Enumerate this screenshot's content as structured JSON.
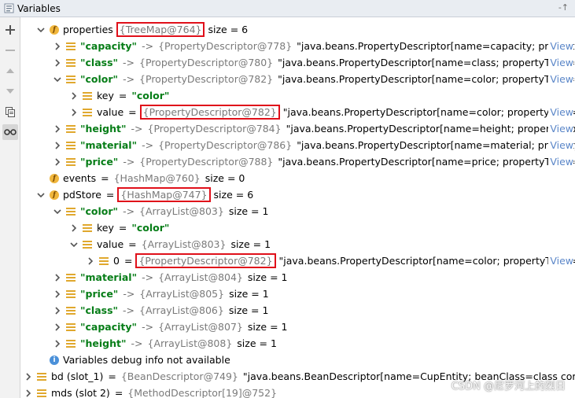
{
  "window": {
    "title": "Variables",
    "pin_glyph": "-↑"
  },
  "toolbar": [
    {
      "name": "add-watch-button",
      "icon": "plus-icon"
    },
    {
      "name": "remove-watch-button",
      "icon": "minus-icon"
    },
    {
      "name": "move-up-button",
      "icon": "arrow-up-icon"
    },
    {
      "name": "move-down-button",
      "icon": "arrow-down-icon"
    },
    {
      "name": "copy-button",
      "icon": "copy-icon"
    },
    {
      "name": "show-watches-button",
      "icon": "glasses-icon"
    }
  ],
  "rows": [
    {
      "indent": 0,
      "arrow": "down",
      "icon": "field",
      "name": "properties",
      "ref": "{TreeMap@764}",
      "boxed": true,
      "size": "size = 6"
    },
    {
      "indent": 1,
      "arrow": "right",
      "icon": "bars",
      "str": "\"capacity\"",
      "arr": "->",
      "ref": "{PropertyDescriptor@778}",
      "val": "\"java.beans.PropertyDescriptor[name=capacity; propertyTy",
      "view": "View"
    },
    {
      "indent": 1,
      "arrow": "right",
      "icon": "bars",
      "str": "\"class\"",
      "arr": "->",
      "ref": "{PropertyDescriptor@780}",
      "val": "\"java.beans.PropertyDescriptor[name=class; propertyType=cla",
      "view": "View"
    },
    {
      "indent": 1,
      "arrow": "down",
      "icon": "bars",
      "str": "\"color\"",
      "arr": "->",
      "ref": "{PropertyDescriptor@782}",
      "val": "\"java.beans.PropertyDescriptor[name=color; propertyType=cl",
      "view": "View"
    },
    {
      "indent": 2,
      "arrow": "right",
      "icon": "bars",
      "name": "key",
      "eq": "=",
      "str": "\"color\""
    },
    {
      "indent": 2,
      "arrow": "right",
      "icon": "bars",
      "name": "value",
      "eq": "=",
      "ref": "{PropertyDescriptor@782}",
      "boxed": true,
      "val": "\"java.beans.PropertyDescriptor[name=color; propertyType=cl",
      "view": "View"
    },
    {
      "indent": 1,
      "arrow": "right",
      "icon": "bars",
      "str": "\"height\"",
      "arr": "->",
      "ref": "{PropertyDescriptor@784}",
      "val": "\"java.beans.PropertyDescriptor[name=height; propertyType:",
      "view": "View"
    },
    {
      "indent": 1,
      "arrow": "right",
      "icon": "bars",
      "str": "\"material\"",
      "arr": "->",
      "ref": "{PropertyDescriptor@786}",
      "val": "\"java.beans.PropertyDescriptor[name=material; propertyTy",
      "view": "View"
    },
    {
      "indent": 1,
      "arrow": "right",
      "icon": "bars",
      "str": "\"price\"",
      "arr": "->",
      "ref": "{PropertyDescriptor@788}",
      "val": "\"java.beans.PropertyDescriptor[name=price; propertyType=cla",
      "view": "View"
    },
    {
      "indent": 0,
      "arrow": "none",
      "icon": "field",
      "name": "events",
      "eq": "=",
      "ref": "{HashMap@760}",
      "size": "size = 0"
    },
    {
      "indent": 0,
      "arrow": "down",
      "icon": "field",
      "name": "pdStore",
      "eq": "=",
      "ref": "{HashMap@747}",
      "boxed": true,
      "size": "size = 6"
    },
    {
      "indent": 1,
      "arrow": "down",
      "icon": "bars",
      "str": "\"color\"",
      "arr": "->",
      "ref": "{ArrayList@803}",
      "size": "size = 1"
    },
    {
      "indent": 2,
      "arrow": "right",
      "icon": "bars",
      "name": "key",
      "eq": "=",
      "str": "\"color\""
    },
    {
      "indent": 2,
      "arrow": "down",
      "icon": "bars",
      "name": "value",
      "eq": "=",
      "ref": "{ArrayList@803}",
      "size": "size = 1"
    },
    {
      "indent": 3,
      "arrow": "right",
      "icon": "bars",
      "name": "0",
      "eq": "=",
      "ref": "{PropertyDescriptor@782}",
      "boxed": true,
      "val": "\"java.beans.PropertyDescriptor[name=color; propertyType=cl",
      "view": "View"
    },
    {
      "indent": 1,
      "arrow": "right",
      "icon": "bars",
      "str": "\"material\"",
      "arr": "->",
      "ref": "{ArrayList@804}",
      "size": "size = 1"
    },
    {
      "indent": 1,
      "arrow": "right",
      "icon": "bars",
      "str": "\"price\"",
      "arr": "->",
      "ref": "{ArrayList@805}",
      "size": "size = 1"
    },
    {
      "indent": 1,
      "arrow": "right",
      "icon": "bars",
      "str": "\"class\"",
      "arr": "->",
      "ref": "{ArrayList@806}",
      "size": "size = 1"
    },
    {
      "indent": 1,
      "arrow": "right",
      "icon": "bars",
      "str": "\"capacity\"",
      "arr": "->",
      "ref": "{ArrayList@807}",
      "size": "size = 1"
    },
    {
      "indent": 1,
      "arrow": "right",
      "icon": "bars",
      "str": "\"height\"",
      "arr": "->",
      "ref": "{ArrayList@808}",
      "size": "size = 1"
    },
    {
      "indent": 0,
      "arrow": "none",
      "icon": "info",
      "name": "Variables debug info not available",
      "plain": true
    },
    {
      "indent": -1,
      "arrow": "right",
      "icon": "bars",
      "name": "bd (slot_1)",
      "eq": "=",
      "ref": "{BeanDescriptor@749}",
      "val": "\"java.beans.BeanDescriptor[name=CupEntity; beanClass=class com.horizon.ni"
    },
    {
      "indent": -1,
      "arrow": "right",
      "icon": "bars",
      "name": "mds (slot 2)",
      "eq": "=",
      "ref": "{MethodDescriptor[19]@752}"
    }
  ],
  "watermark": "CSDN @尼罗河上的烈日"
}
